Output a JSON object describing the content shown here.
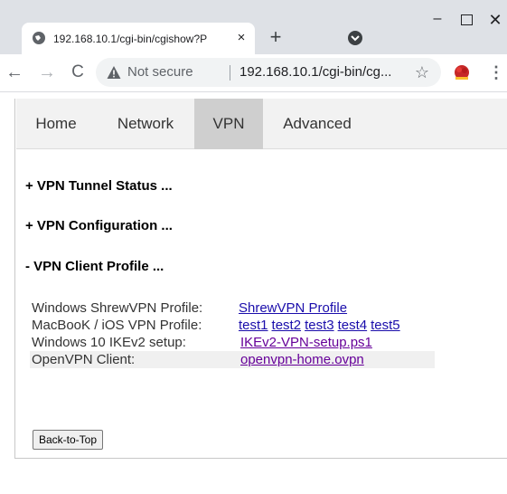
{
  "browser": {
    "tab_title": "192.168.10.1/cgi-bin/cgishow?P",
    "tab_close": "×",
    "new_tab": "+",
    "address": {
      "security_label": "Not secure",
      "url": "192.168.10.1/cgi-bin/cg..."
    },
    "icons": {
      "favicon": "globe-icon",
      "tab_search": "tab-search-icon",
      "back": "back-arrow-icon",
      "forward": "forward-arrow-icon",
      "reload": "reload-icon",
      "warning": "warning-triangle-icon",
      "bookmark": "star-icon",
      "extension": "extension-icon",
      "menu": "kebab-menu-icon"
    }
  },
  "page": {
    "nav": [
      {
        "label": "Home",
        "active": false
      },
      {
        "label": "Network",
        "active": false
      },
      {
        "label": "VPN",
        "active": true
      },
      {
        "label": "Advanced",
        "active": false
      }
    ],
    "sections": {
      "tunnel_status": "+ VPN Tunnel Status ...",
      "configuration": "+ VPN Configuration ...",
      "client_profile": "- VPN Client Profile ..."
    },
    "profiles": [
      {
        "label": "Windows ShrewVPN Profile:",
        "links": [
          "ShrewVPN Profile"
        ]
      },
      {
        "label": "MacBooK / iOS VPN Profile:",
        "links": [
          "test1",
          "test2",
          "test3",
          "test4",
          "test5"
        ]
      },
      {
        "label": "Windows 10 IKEv2 setup:",
        "links": [
          "IKEv2-VPN-setup.ps1"
        ]
      },
      {
        "label": "OpenVPN Client:",
        "links": [
          "openvpn-home.ovpn"
        ]
      }
    ],
    "back_to_top": "Back-to-Top"
  },
  "colors": {
    "link": "#1a0dab",
    "visited_link": "#660099",
    "nav_active_bg": "#cfcfcf",
    "nav_bg": "#f2f2f2"
  }
}
